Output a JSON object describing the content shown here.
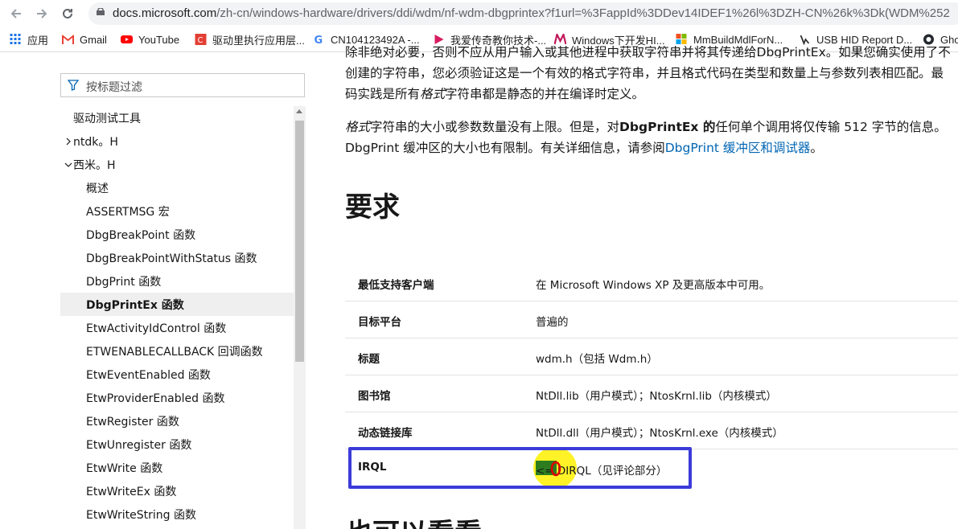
{
  "browser": {
    "url_host": "docs.microsoft.com",
    "url_path": "/zh-cn/windows-hardware/drivers/ddi/wdm/nf-wdm-dbgprintex?f1url=%3FappId%3DDev14IDEF1%26l%3DZH-CN%26k%3Dk(WDM%252",
    "bookmarks": [
      "应用",
      "Gmail",
      "YouTube",
      "驱动里执行应用层...",
      "CN104123492A -...",
      "我爱传奇教你技术-...",
      "Windows下开发HI...",
      "MmBuildMdlForN...",
      "USB HID Report D...",
      "Gho"
    ]
  },
  "sidebar": {
    "filter_placeholder": "按标题过滤",
    "items": [
      {
        "label": "驱动测试工具"
      },
      {
        "label": "ntdk。H"
      },
      {
        "label": "西米。H"
      },
      {
        "label": "概述"
      },
      {
        "label": "ASSERTMSG 宏"
      },
      {
        "label": "DbgBreakPoint 函数"
      },
      {
        "label": "DbgBreakPointWithStatus 函数"
      },
      {
        "label": "DbgPrint 函数"
      },
      {
        "label": "DbgPrintEx 函数"
      },
      {
        "label": "EtwActivityIdControl 函数"
      },
      {
        "label": "ETWENABLECALLBACK 回调函数"
      },
      {
        "label": "EtwEventEnabled 函数"
      },
      {
        "label": "EtwProviderEnabled 函数"
      },
      {
        "label": "EtwRegister 函数"
      },
      {
        "label": "EtwUnregister 函数"
      },
      {
        "label": "EtwWrite 函数"
      },
      {
        "label": "EtwWriteEx 函数"
      },
      {
        "label": "EtwWriteString 函数"
      }
    ]
  },
  "content": {
    "para1_line1": "除非绝对必要，否则不应从用户输入或其他进程中获取字符串并将其传递给DbgPrintEx。如果您确实使用了不",
    "para1_line2": "创建的字符串，您必须验证这是一个有效的格式字符串，并且格式代码在类型和数量上与参数列表相匹配。最",
    "para1_line3a": "码实践是所有",
    "para1_line3_em": "格式",
    "para1_line3b": "字符串都是静态的并在编译时定义。",
    "para2_em": "格式",
    "para2_a": "字符串的大小或参数数量没有上限。但是，对",
    "para2_bold": "DbgPrintEx 的",
    "para2_b": "任何单个调用将仅传输 512 字节的信息。",
    "para2_line2": "DbgPrint 缓冲区的大小也有限制。有关详细信息，请参阅",
    "para2_link": "DbgPrint 缓冲区和调试器",
    "para2_end": "。",
    "heading_requirements": "要求",
    "requirements": [
      {
        "key": "最低支持客户端",
        "value": "在 Microsoft Windows XP 及更高版本中可用。"
      },
      {
        "key": "目标平台",
        "value": "普遍的"
      },
      {
        "key": "标题",
        "value": "wdm.h（包括 Wdm.h）"
      },
      {
        "key": "图书馆",
        "value": "NtDll.lib（用户模式）；NtosKrnl.lib（内核模式）"
      },
      {
        "key": "动态链接库",
        "value": "NtDll.dll（用户模式）；NtosKrnl.exe（内核模式）"
      },
      {
        "key": "IRQL",
        "value": "<= DIRQL（见评论部分）"
      }
    ],
    "heading_see_also": "也可以看看"
  }
}
